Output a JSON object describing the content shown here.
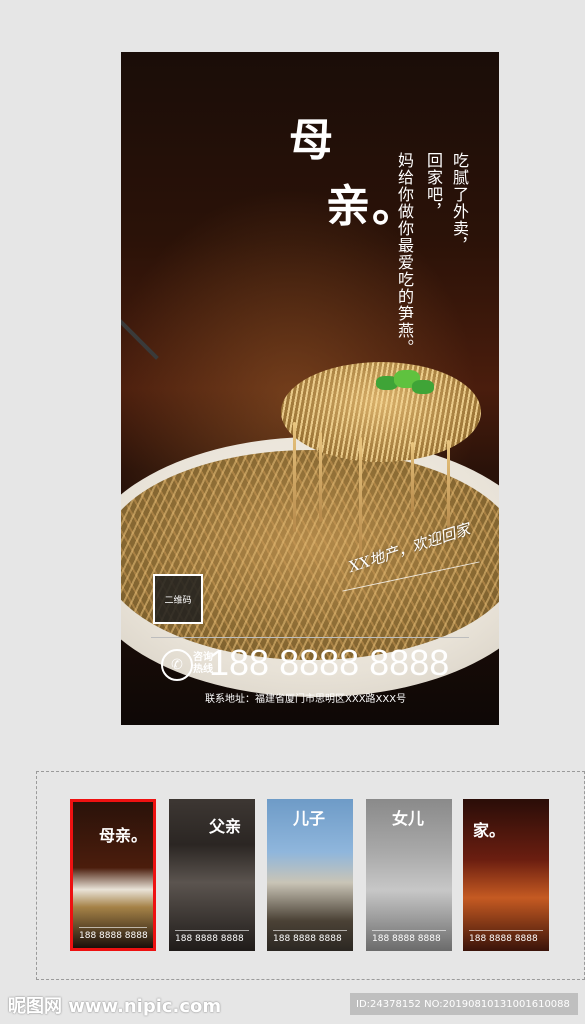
{
  "poster": {
    "title_line1": "母",
    "title_line2": "亲。",
    "verse_col1": "吃腻了外卖，",
    "verse_col2": "回家吧，",
    "verse_col3": "妈给你做你最爱吃的笋燕。",
    "script_text": "XX地产，欢迎回家",
    "qr_label": "二维码",
    "hotline_label": "咨询热线",
    "phone": "188 8888 8888",
    "address": "联系地址：福建省厦门市思明区XXX路XXX号"
  },
  "thumbnails": [
    {
      "title": "母亲。",
      "phone": "188 8888 8888",
      "selected": true
    },
    {
      "title": "父亲",
      "phone": "188 8888 8888",
      "selected": false
    },
    {
      "title": "儿子",
      "phone": "188 8888 8888",
      "selected": false
    },
    {
      "title": "女儿",
      "phone": "188 8888 8888",
      "selected": false
    },
    {
      "title": "家。",
      "phone": "188 8888 8888",
      "selected": false
    }
  ],
  "footer": {
    "watermark": "昵图网 www.nipic.com",
    "id_text": "ID:24378152 NO:20190810131001610088"
  }
}
